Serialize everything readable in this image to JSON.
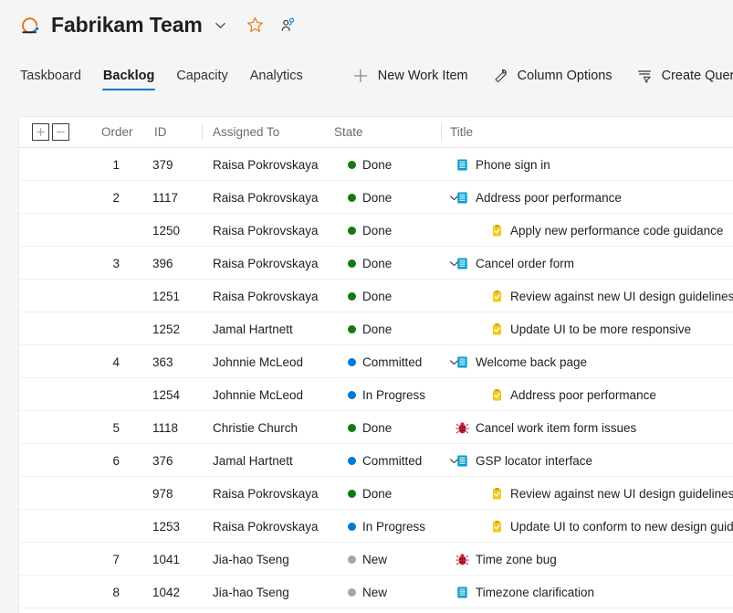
{
  "header": {
    "project_icon": "azure-devops-project-icon",
    "title": "Fabrikam Team",
    "chevron": "chevron-down-icon",
    "favorite_icon": "star-icon",
    "members_icon": "team-members-icon"
  },
  "tabs": [
    {
      "label": "Taskboard",
      "active": false
    },
    {
      "label": "Backlog",
      "active": true
    },
    {
      "label": "Capacity",
      "active": false
    },
    {
      "label": "Analytics",
      "active": false
    }
  ],
  "toolbar": [
    {
      "label": "New Work Item",
      "icon": "plus-icon"
    },
    {
      "label": "Column Options",
      "icon": "wrench-icon"
    },
    {
      "label": "Create Query",
      "icon": "filter-list-icon"
    }
  ],
  "grid": {
    "expand_all_label": "+",
    "collapse_all_label": "–",
    "columns": [
      {
        "key": "order",
        "label": "Order"
      },
      {
        "key": "id",
        "label": "ID"
      },
      {
        "key": "assigned",
        "label": "Assigned To"
      },
      {
        "key": "state",
        "label": "State"
      },
      {
        "key": "title",
        "label": "Title"
      }
    ],
    "state_colors": {
      "Done": "#107c10",
      "Committed": "#0078d4",
      "In Progress": "#0078d4",
      "New": "#a6a6a6"
    },
    "rows": [
      {
        "order": "1",
        "id": "379",
        "assigned": "Raisa Pokrovskaya",
        "state": "Done",
        "title": "Phone sign in",
        "type": "user-story",
        "indent": 0,
        "chevron": false
      },
      {
        "order": "2",
        "id": "1117",
        "assigned": "Raisa Pokrovskaya",
        "state": "Done",
        "title": "Address poor performance",
        "type": "user-story",
        "indent": 0,
        "chevron": true
      },
      {
        "order": "",
        "id": "1250",
        "assigned": "Raisa Pokrovskaya",
        "state": "Done",
        "title": "Apply new performance code guidance",
        "type": "task",
        "indent": 1,
        "chevron": false
      },
      {
        "order": "3",
        "id": "396",
        "assigned": "Raisa Pokrovskaya",
        "state": "Done",
        "title": "Cancel order form",
        "type": "user-story",
        "indent": 0,
        "chevron": true
      },
      {
        "order": "",
        "id": "1251",
        "assigned": "Raisa Pokrovskaya",
        "state": "Done",
        "title": "Review against new UI design guidelines",
        "type": "task",
        "indent": 1,
        "chevron": false
      },
      {
        "order": "",
        "id": "1252",
        "assigned": "Jamal Hartnett",
        "state": "Done",
        "title": "Update UI to be more responsive",
        "type": "task",
        "indent": 1,
        "chevron": false
      },
      {
        "order": "4",
        "id": "363",
        "assigned": "Johnnie McLeod",
        "state": "Committed",
        "title": "Welcome back page",
        "type": "user-story",
        "indent": 0,
        "chevron": true
      },
      {
        "order": "",
        "id": "1254",
        "assigned": "Johnnie McLeod",
        "state": "In Progress",
        "title": "Address poor performance",
        "type": "task",
        "indent": 1,
        "chevron": false
      },
      {
        "order": "5",
        "id": "1118",
        "assigned": "Christie Church",
        "state": "Done",
        "title": "Cancel work item form issues",
        "type": "bug",
        "indent": 0,
        "chevron": false
      },
      {
        "order": "6",
        "id": "376",
        "assigned": "Jamal Hartnett",
        "state": "Committed",
        "title": "GSP locator interface",
        "type": "user-story",
        "indent": 0,
        "chevron": true
      },
      {
        "order": "",
        "id": "978",
        "assigned": "Raisa Pokrovskaya",
        "state": "Done",
        "title": "Review against new UI design guidelines",
        "type": "task",
        "indent": 1,
        "chevron": false
      },
      {
        "order": "",
        "id": "1253",
        "assigned": "Raisa Pokrovskaya",
        "state": "In Progress",
        "title": "Update UI to conform to new design guidelines",
        "type": "task",
        "indent": 1,
        "chevron": false
      },
      {
        "order": "7",
        "id": "1041",
        "assigned": "Jia-hao Tseng",
        "state": "New",
        "title": "Time zone bug",
        "type": "bug",
        "indent": 0,
        "chevron": false
      },
      {
        "order": "8",
        "id": "1042",
        "assigned": "Jia-hao Tseng",
        "state": "New",
        "title": "Timezone clarification",
        "type": "user-story",
        "indent": 0,
        "chevron": false
      }
    ]
  }
}
